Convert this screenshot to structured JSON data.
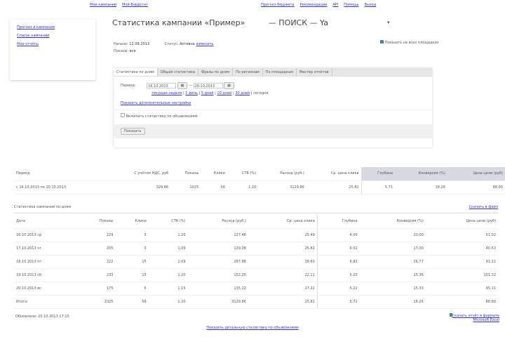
{
  "top_links": [
    "Мои кампании",
    "Мой Вордстат",
    "Прогноз бюджета",
    "Рекомендации",
    "API",
    "Помощь",
    "Выход"
  ],
  "sidebar": [
    "Прогноз и кампании",
    "Список кампаний",
    "Мои отчёты"
  ],
  "title": "Статистика кампании «Пример»",
  "title_suffix": "— ПОИСК — Ya",
  "info": {
    "start_label": "Начало:",
    "start": "12.09.2013",
    "status_label": "Статус:",
    "status": "Активна",
    "status_link": "изменить",
    "strategy_label": "Показы:",
    "strategy": "все"
  },
  "option": "Показать на всех площадках",
  "tabs": [
    "Статистика по дням",
    "Общая статистика",
    "Фразы по дням",
    "По регионам",
    "По площадкам",
    "Мастер отчётов"
  ],
  "period_label": "Период:",
  "date_from": "16.10.2013",
  "date_to": "20.10.2013",
  "dash": "—",
  "quick": [
    "текущая неделя",
    "1 день",
    "5 дней",
    "10 дней",
    "30 дней",
    "сегодня"
  ],
  "more_settings": "Показать дополнительные настройки",
  "checkbox": "Включать статистику по объявлениям",
  "submit": "Показать",
  "summary": {
    "headers": [
      "Период",
      "С учётом НДС, руб",
      "Показы",
      "Клики",
      "CTR (%)",
      "Расход (руб.)",
      "Ср. цена клика",
      "Глубина",
      "Конверсия (%)",
      "Цена цели (руб)"
    ],
    "row": [
      "с 16.10.2013 по 20.10.2013",
      "329.86",
      "1025",
      "56",
      "1.20",
      "3129.86",
      "25.82",
      "5.71",
      "18.26",
      "88.60"
    ]
  },
  "daily": {
    "title": "Статистика кампании по дням",
    "export": "Скачать в файл",
    "headers": [
      "Дата",
      "Показы",
      "Клики",
      "CTR (%)",
      "Расход (руб.)",
      "Ср. цена клика",
      "Глубина",
      "Конверсия (%)",
      "Цена цели (руб)"
    ],
    "rows": [
      [
        "16.10.2013 ср",
        "229",
        "5",
        "1.20",
        "127.46",
        "25.49",
        "4.00",
        "20.00",
        "51.02"
      ],
      [
        "17.10.2013 чт",
        "205",
        "5",
        "1.09",
        "129.08",
        "25.82",
        "6.02",
        "27.00",
        "40.53"
      ],
      [
        "18.10.2013 пт",
        "222",
        "15",
        "1.09",
        "287.88",
        "28.60",
        "6.82",
        "26.77",
        "91.22"
      ],
      [
        "19.10.2013 сб",
        "233",
        "15",
        "1.20",
        "152.26",
        "22.11",
        "5.20",
        "15.36",
        "101.32"
      ],
      [
        "20.10.2013 вс",
        "175",
        "5",
        "1.15",
        "135.22",
        "27.22",
        "5.21",
        "15.33",
        "95.11"
      ],
      [
        "Итого",
        "1025",
        "56",
        "1.20",
        "3129.86",
        "25.82",
        "5.71",
        "18.26",
        "88.60"
      ]
    ]
  },
  "updated": "Обновлено: 20.10.2013 17:15",
  "excel": "Скачать отчёт в формате",
  "excel2": "Microsoft Excel",
  "bottom_link": "Показать детальную статистику по объявлениям"
}
